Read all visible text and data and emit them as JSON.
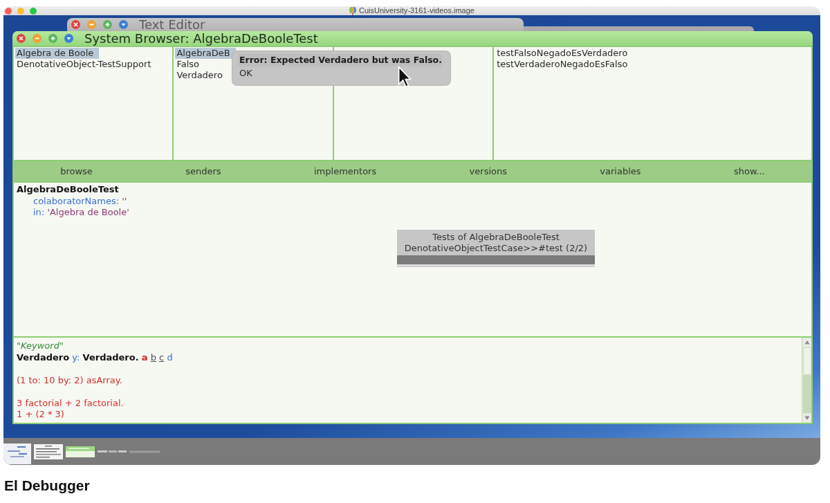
{
  "host_window": {
    "title": "CuisUniversity-3161-videos.image"
  },
  "text_editor": {
    "title": "Text Editor"
  },
  "browser": {
    "title": "System Browser: AlgebraDeBooleTest",
    "panes": [
      {
        "items": [
          {
            "label": "Algebra de Boole",
            "selected": true
          },
          {
            "label": "DenotativeObject-TestSupport",
            "selected": false
          }
        ]
      },
      {
        "items": [
          {
            "label": "AlgebraDeB",
            "selected": true
          },
          {
            "label": "Falso",
            "selected": false
          },
          {
            "label": "Verdadero",
            "selected": false
          }
        ]
      },
      {
        "items": [
          {
            "label": "testFalsoNegadoEsVerdadero",
            "selected": false
          },
          {
            "label": "testVerdaderoNegadoEsFalso",
            "selected": false
          }
        ]
      }
    ],
    "buttons": [
      "browse",
      "senders",
      "implementors",
      "versions",
      "variables",
      "show..."
    ],
    "definition": [
      {
        "segments": [
          {
            "text": "AlgebraDeBooleTest",
            "kind": "class"
          }
        ],
        "children": [
          {
            "segments": [
              {
                "text": "colaboratorNames:",
                "kind": "keyword"
              },
              {
                "text": "''",
                "kind": "string"
              }
            ]
          },
          {
            "segments": [
              {
                "text": "in:",
                "kind": "keyword"
              },
              {
                "text": "'Algebra de Boole'",
                "kind": "string"
              }
            ]
          }
        ]
      }
    ]
  },
  "error_popup": {
    "message": "Error: Expected Verdadero but was Falso.",
    "options": [
      "OK"
    ]
  },
  "progress_dialog": {
    "title": "Tests of AlgebraDeBooleTest",
    "detail": "DenotativeObjectTestCase>>#test (2/2)",
    "level": 1
  },
  "workspace": {
    "paragraphs": [
      {
        "lines": [
          {
            "segments": [
              {
                "text": "\"Keyword\"",
                "kind": "comment"
              }
            ]
          },
          {
            "segments": [
              {
                "text": "Verdadero",
                "kind": "class"
              },
              {
                "text": "y:",
                "kind": "keyword"
              },
              {
                "text": "Verdadero.",
                "kind": "class"
              },
              {
                "text": "a",
                "kind": "undeclared"
              },
              {
                "text": "b",
                "kind": "pending"
              },
              {
                "text": "c",
                "kind": "pending"
              },
              {
                "text": "d",
                "kind": "variable"
              }
            ]
          }
        ]
      },
      {
        "lines": [
          {
            "segments": [
              {
                "text": "(1 to: 10 by: 2) asArray.",
                "kind": "error"
              }
            ]
          }
        ]
      },
      {
        "lines": [
          {
            "segments": [
              {
                "text": "3 factorial + 2 factorial.",
                "kind": "error"
              }
            ]
          },
          {
            "segments": [
              {
                "text": "1 + (2 * 3)",
                "kind": "error"
              }
            ]
          }
        ]
      }
    ]
  },
  "caption": "El Debugger"
}
